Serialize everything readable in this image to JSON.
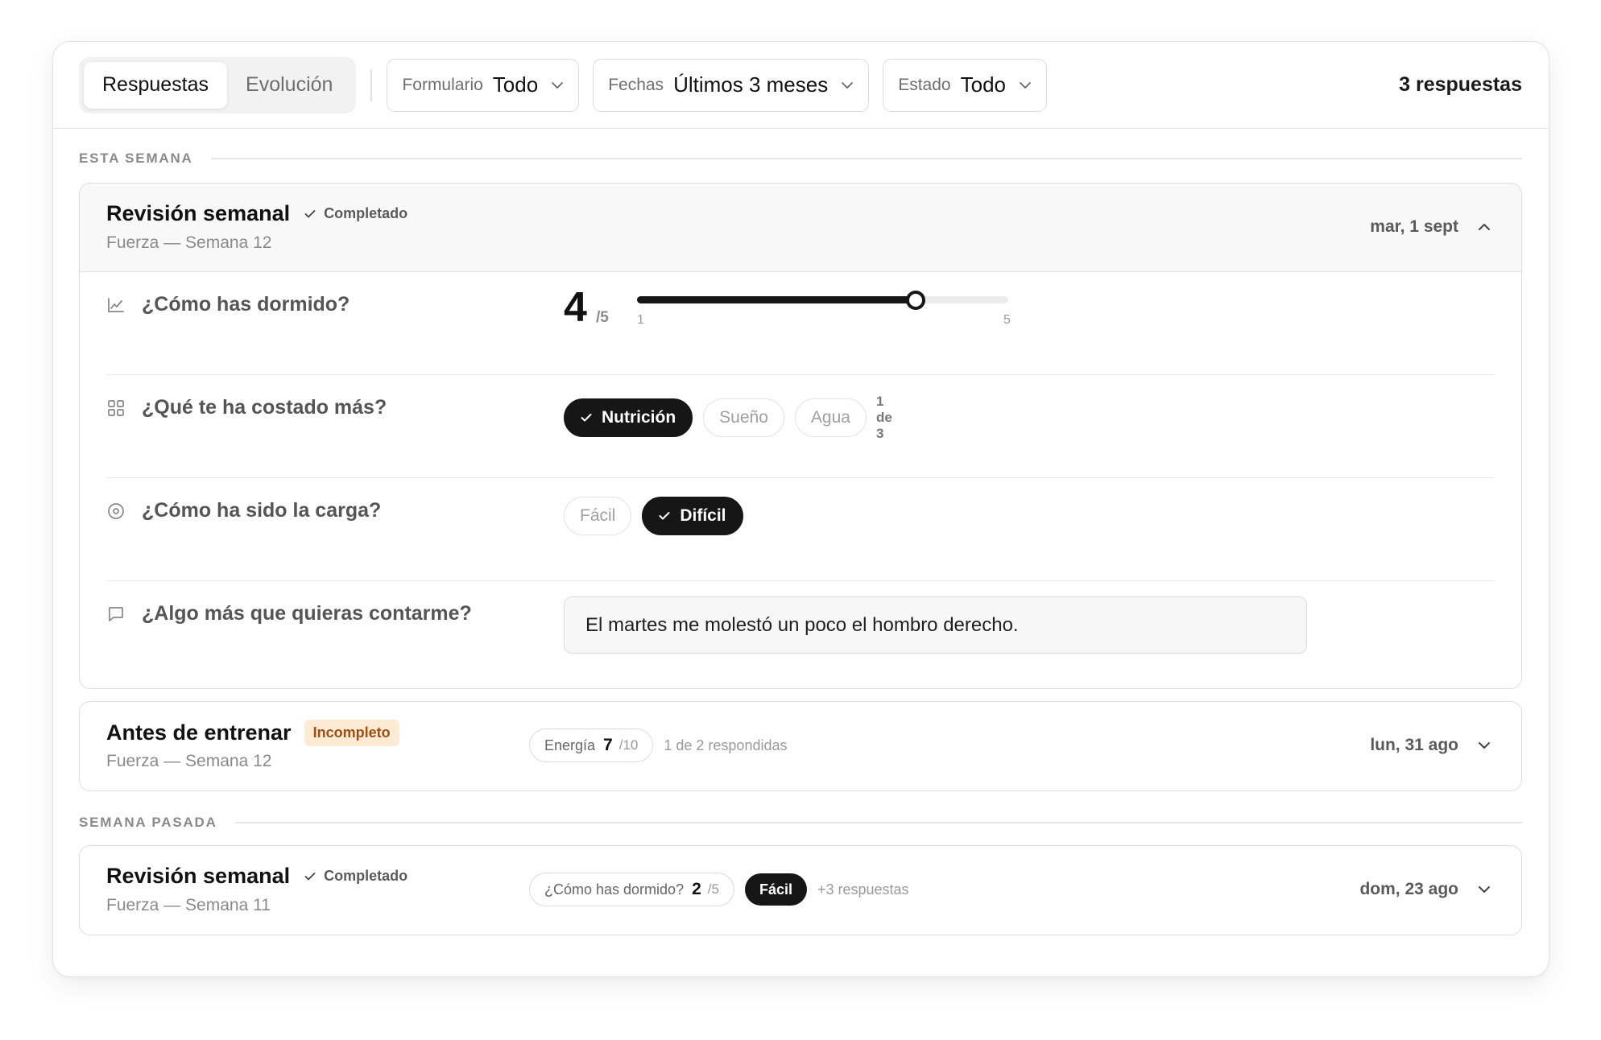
{
  "toolbar": {
    "tabs": [
      {
        "label": "Respuestas",
        "active": true
      },
      {
        "label": "Evolución",
        "active": false
      }
    ],
    "filters": [
      {
        "label": "Formulario",
        "value": "Todo"
      },
      {
        "label": "Fechas",
        "value": "Últimos 3 meses"
      },
      {
        "label": "Estado",
        "value": "Todo"
      }
    ],
    "count": "3 respuestas"
  },
  "sections": [
    {
      "title": "ESTA SEMANA",
      "entries": [
        {
          "title": "Revisión semanal",
          "status": "Completado",
          "subtitle": "Fuerza — Semana 12",
          "date": "mar, 1 sept",
          "expanded": true,
          "questions": [
            {
              "icon": "line-chart-icon",
              "label": "¿Cómo has dormido?",
              "type": "rating",
              "value": "4",
              "den": "/5",
              "min": "1",
              "max": "5",
              "level": 4
            },
            {
              "icon": "grid-icon",
              "label": "¿Qué te ha costado más?",
              "type": "multi",
              "options": [
                {
                  "label": "Nutrición",
                  "selected": true
                },
                {
                  "label": "Sueño",
                  "selected": false
                },
                {
                  "label": "Agua",
                  "selected": false
                }
              ],
              "meta": "1 de 3"
            },
            {
              "icon": "target-icon",
              "label": "¿Cómo ha sido la carga?",
              "type": "single",
              "options": [
                {
                  "label": "Fácil",
                  "selected": false
                },
                {
                  "label": "Difícil",
                  "selected": true
                }
              ]
            },
            {
              "icon": "message-icon",
              "label": "¿Algo más que quieras contarme?",
              "type": "text",
              "value": "El martes me molestó un poco el hombro derecho."
            }
          ]
        },
        {
          "title": "Antes de entrenar",
          "status": "Incompleto",
          "subtitle": "Fuerza — Semana 12",
          "date": "lun, 31 ago",
          "expanded": false,
          "summary": {
            "pill_label": "Energía",
            "pill_value": "7",
            "pill_den": "/10",
            "meta": "1 de 2 respondidas"
          }
        }
      ]
    },
    {
      "title": "SEMANA PASADA",
      "entries": [
        {
          "title": "Revisión semanal",
          "status": "Completado",
          "subtitle": "Fuerza — Semana 11",
          "date": "dom, 23 ago",
          "expanded": false,
          "summary": {
            "pill_label": "¿Cómo has dormido?",
            "pill_value": "2",
            "pill_den": "/5",
            "dark_pill": "Fácil",
            "meta": "+3 respuestas"
          }
        }
      ]
    }
  ]
}
